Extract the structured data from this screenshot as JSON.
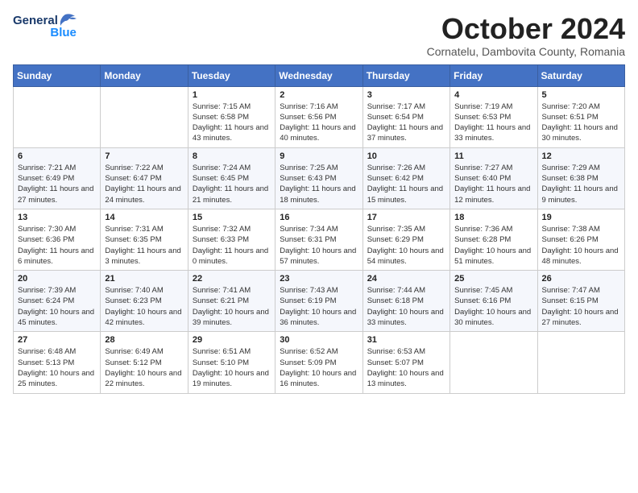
{
  "header": {
    "logo_general": "General",
    "logo_blue": "Blue",
    "month_title": "October 2024",
    "subtitle": "Cornatelu, Dambovita County, Romania"
  },
  "days_of_week": [
    "Sunday",
    "Monday",
    "Tuesday",
    "Wednesday",
    "Thursday",
    "Friday",
    "Saturday"
  ],
  "weeks": [
    [
      {
        "day": "",
        "detail": ""
      },
      {
        "day": "",
        "detail": ""
      },
      {
        "day": "1",
        "detail": "Sunrise: 7:15 AM\nSunset: 6:58 PM\nDaylight: 11 hours and 43 minutes."
      },
      {
        "day": "2",
        "detail": "Sunrise: 7:16 AM\nSunset: 6:56 PM\nDaylight: 11 hours and 40 minutes."
      },
      {
        "day": "3",
        "detail": "Sunrise: 7:17 AM\nSunset: 6:54 PM\nDaylight: 11 hours and 37 minutes."
      },
      {
        "day": "4",
        "detail": "Sunrise: 7:19 AM\nSunset: 6:53 PM\nDaylight: 11 hours and 33 minutes."
      },
      {
        "day": "5",
        "detail": "Sunrise: 7:20 AM\nSunset: 6:51 PM\nDaylight: 11 hours and 30 minutes."
      }
    ],
    [
      {
        "day": "6",
        "detail": "Sunrise: 7:21 AM\nSunset: 6:49 PM\nDaylight: 11 hours and 27 minutes."
      },
      {
        "day": "7",
        "detail": "Sunrise: 7:22 AM\nSunset: 6:47 PM\nDaylight: 11 hours and 24 minutes."
      },
      {
        "day": "8",
        "detail": "Sunrise: 7:24 AM\nSunset: 6:45 PM\nDaylight: 11 hours and 21 minutes."
      },
      {
        "day": "9",
        "detail": "Sunrise: 7:25 AM\nSunset: 6:43 PM\nDaylight: 11 hours and 18 minutes."
      },
      {
        "day": "10",
        "detail": "Sunrise: 7:26 AM\nSunset: 6:42 PM\nDaylight: 11 hours and 15 minutes."
      },
      {
        "day": "11",
        "detail": "Sunrise: 7:27 AM\nSunset: 6:40 PM\nDaylight: 11 hours and 12 minutes."
      },
      {
        "day": "12",
        "detail": "Sunrise: 7:29 AM\nSunset: 6:38 PM\nDaylight: 11 hours and 9 minutes."
      }
    ],
    [
      {
        "day": "13",
        "detail": "Sunrise: 7:30 AM\nSunset: 6:36 PM\nDaylight: 11 hours and 6 minutes."
      },
      {
        "day": "14",
        "detail": "Sunrise: 7:31 AM\nSunset: 6:35 PM\nDaylight: 11 hours and 3 minutes."
      },
      {
        "day": "15",
        "detail": "Sunrise: 7:32 AM\nSunset: 6:33 PM\nDaylight: 11 hours and 0 minutes."
      },
      {
        "day": "16",
        "detail": "Sunrise: 7:34 AM\nSunset: 6:31 PM\nDaylight: 10 hours and 57 minutes."
      },
      {
        "day": "17",
        "detail": "Sunrise: 7:35 AM\nSunset: 6:29 PM\nDaylight: 10 hours and 54 minutes."
      },
      {
        "day": "18",
        "detail": "Sunrise: 7:36 AM\nSunset: 6:28 PM\nDaylight: 10 hours and 51 minutes."
      },
      {
        "day": "19",
        "detail": "Sunrise: 7:38 AM\nSunset: 6:26 PM\nDaylight: 10 hours and 48 minutes."
      }
    ],
    [
      {
        "day": "20",
        "detail": "Sunrise: 7:39 AM\nSunset: 6:24 PM\nDaylight: 10 hours and 45 minutes."
      },
      {
        "day": "21",
        "detail": "Sunrise: 7:40 AM\nSunset: 6:23 PM\nDaylight: 10 hours and 42 minutes."
      },
      {
        "day": "22",
        "detail": "Sunrise: 7:41 AM\nSunset: 6:21 PM\nDaylight: 10 hours and 39 minutes."
      },
      {
        "day": "23",
        "detail": "Sunrise: 7:43 AM\nSunset: 6:19 PM\nDaylight: 10 hours and 36 minutes."
      },
      {
        "day": "24",
        "detail": "Sunrise: 7:44 AM\nSunset: 6:18 PM\nDaylight: 10 hours and 33 minutes."
      },
      {
        "day": "25",
        "detail": "Sunrise: 7:45 AM\nSunset: 6:16 PM\nDaylight: 10 hours and 30 minutes."
      },
      {
        "day": "26",
        "detail": "Sunrise: 7:47 AM\nSunset: 6:15 PM\nDaylight: 10 hours and 27 minutes."
      }
    ],
    [
      {
        "day": "27",
        "detail": "Sunrise: 6:48 AM\nSunset: 5:13 PM\nDaylight: 10 hours and 25 minutes."
      },
      {
        "day": "28",
        "detail": "Sunrise: 6:49 AM\nSunset: 5:12 PM\nDaylight: 10 hours and 22 minutes."
      },
      {
        "day": "29",
        "detail": "Sunrise: 6:51 AM\nSunset: 5:10 PM\nDaylight: 10 hours and 19 minutes."
      },
      {
        "day": "30",
        "detail": "Sunrise: 6:52 AM\nSunset: 5:09 PM\nDaylight: 10 hours and 16 minutes."
      },
      {
        "day": "31",
        "detail": "Sunrise: 6:53 AM\nSunset: 5:07 PM\nDaylight: 10 hours and 13 minutes."
      },
      {
        "day": "",
        "detail": ""
      },
      {
        "day": "",
        "detail": ""
      }
    ]
  ]
}
